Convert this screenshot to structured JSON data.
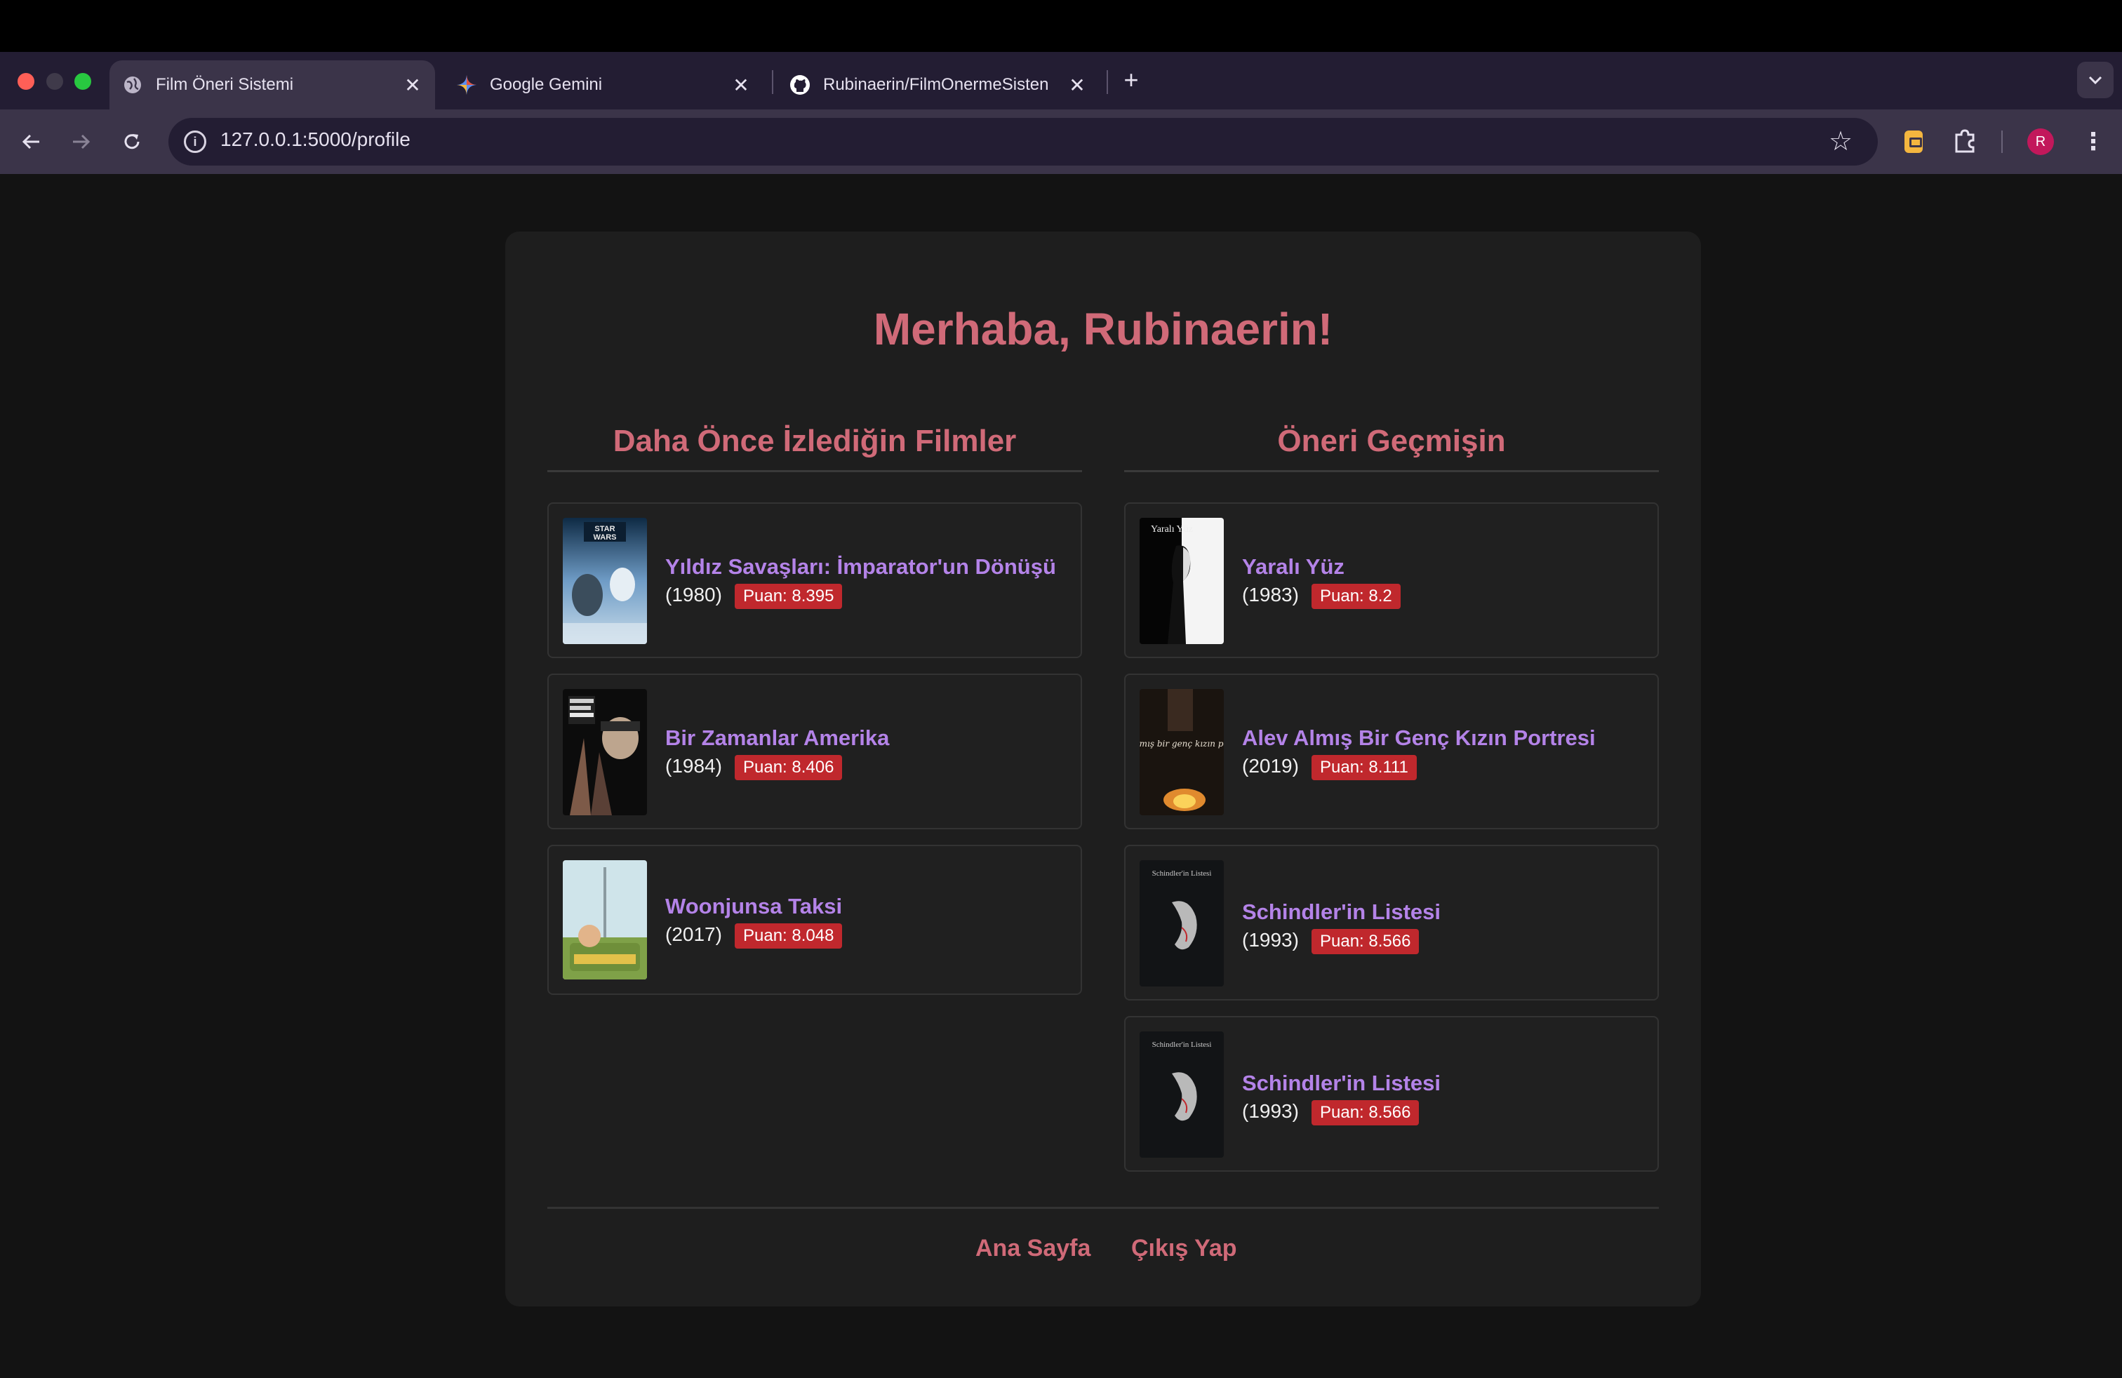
{
  "browser": {
    "tabs": [
      {
        "label": "Film Öneri Sistemi",
        "icon": "globe-icon",
        "active": true
      },
      {
        "label": "Google Gemini",
        "icon": "gemini-icon",
        "active": false
      },
      {
        "label": "Rubinaerin/FilmOnermeSisten",
        "icon": "github-icon",
        "active": false
      }
    ],
    "url": "127.0.0.1:5000/profile",
    "avatar_letter": "R"
  },
  "page": {
    "greeting": "Merhaba, Rubinaerin!",
    "watched": {
      "title": "Daha Önce İzlediğin Filmler",
      "movies": [
        {
          "title": "Yıldız Savaşları: İmparator'un Dönüşü",
          "year": "(1980)",
          "score": "Puan: 8.395",
          "poster": "star-wars-poster"
        },
        {
          "title": "Bir Zamanlar Amerika",
          "year": "(1984)",
          "score": "Puan: 8.406",
          "poster": "once-upon-a-time-in-america-poster"
        },
        {
          "title": "Woonjunsa Taksi",
          "year": "(2017)",
          "score": "Puan: 8.048",
          "poster": "taxi-driver-poster"
        }
      ]
    },
    "history": {
      "title": "Öneri Geçmişin",
      "movies": [
        {
          "title": "Yaralı Yüz",
          "year": "(1983)",
          "score": "Puan: 8.2",
          "poster": "scarface-poster",
          "poster_text": "Yaralı Yüz"
        },
        {
          "title": "Alev Almış Bir Genç Kızın Portresi",
          "year": "(2019)",
          "score": "Puan: 8.111",
          "poster": "portrait-poster",
          "poster_text": "alev almış bir genç kızın portresi"
        },
        {
          "title": "Schindler'in Listesi",
          "year": "(1993)",
          "score": "Puan: 8.566",
          "poster": "schindler-poster",
          "poster_text": "Schindler'in Listesi"
        },
        {
          "title": "Schindler'in Listesi",
          "year": "(1993)",
          "score": "Puan: 8.566",
          "poster": "schindler-poster",
          "poster_text": "Schindler'in Listesi"
        }
      ]
    },
    "footer": {
      "home": "Ana Sayfa",
      "logout": "Çıkış Yap"
    }
  },
  "colors": {
    "accent": "#d06a78",
    "movie_title": "#b483e8",
    "badge": "#c0282d",
    "card_bg": "#1e1e1e",
    "page_bg": "#131313"
  }
}
